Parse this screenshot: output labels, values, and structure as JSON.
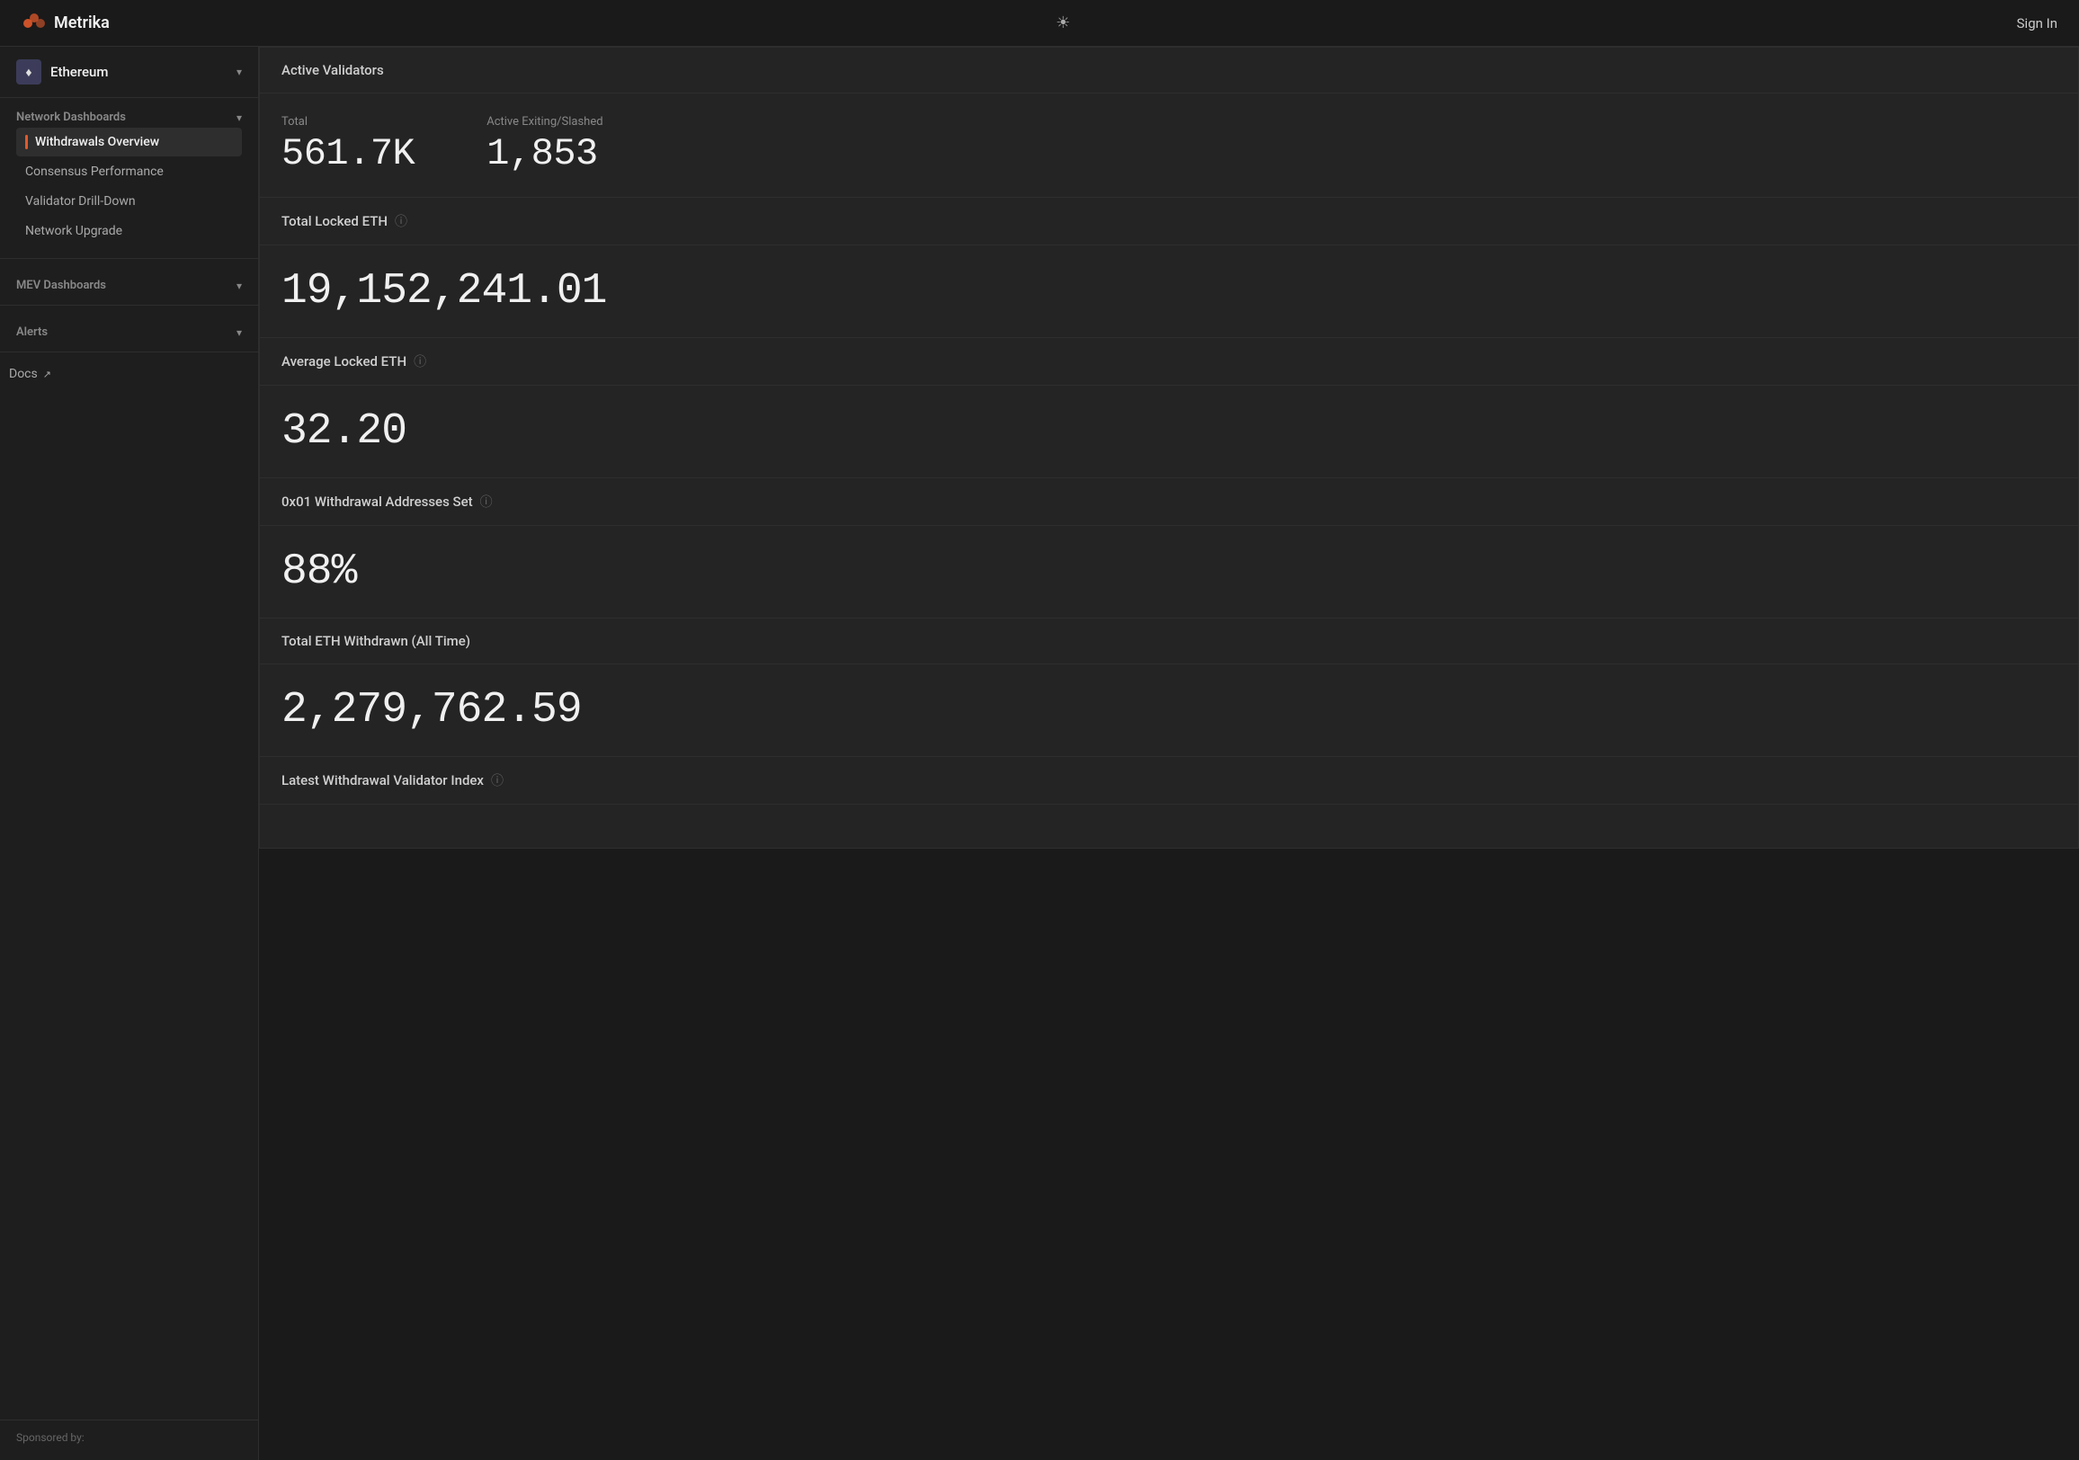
{
  "topnav": {
    "brand_name": "Metrika",
    "sign_in_label": "Sign In",
    "theme_icon": "☀"
  },
  "sidebar": {
    "network_name": "Ethereum",
    "network_icon": "♦",
    "sections": [
      {
        "id": "network-dashboards",
        "title": "Network Dashboards",
        "expanded": true,
        "items": [
          {
            "id": "withdrawals-overview",
            "label": "Withdrawals Overview",
            "active": true
          },
          {
            "id": "consensus-performance",
            "label": "Consensus Performance",
            "active": false
          },
          {
            "id": "validator-drill-down",
            "label": "Validator Drill-Down",
            "active": false
          },
          {
            "id": "network-upgrade",
            "label": "Network Upgrade",
            "active": false
          }
        ]
      },
      {
        "id": "mev-dashboards",
        "title": "MEV Dashboards",
        "expanded": false,
        "items": []
      },
      {
        "id": "alerts",
        "title": "Alerts",
        "expanded": false,
        "items": []
      }
    ],
    "docs_label": "Docs",
    "sponsored_label": "Sponsored by:"
  },
  "cards": [
    {
      "id": "active-validators",
      "title": "Active Validators",
      "has_info": false,
      "stats": [
        {
          "label": "Total",
          "value": "561.7K"
        },
        {
          "label": "Active Exiting/Slashed",
          "value": "1,853"
        }
      ]
    },
    {
      "id": "total-locked-eth",
      "title": "Total Locked ETH",
      "has_info": true,
      "value": "19,152,241.01"
    },
    {
      "id": "average-locked-eth",
      "title": "Average Locked ETH",
      "has_info": true,
      "value": "32.20"
    },
    {
      "id": "withdrawal-addresses",
      "title": "0x01 Withdrawal Addresses Set",
      "has_info": true,
      "value": "88%"
    },
    {
      "id": "total-eth-withdrawn",
      "title": "Total ETH Withdrawn (All Time)",
      "has_info": false,
      "value": "2,279,762.59"
    },
    {
      "id": "latest-withdrawal-index",
      "title": "Latest Withdrawal Validator Index",
      "has_info": true,
      "value": ""
    }
  ]
}
